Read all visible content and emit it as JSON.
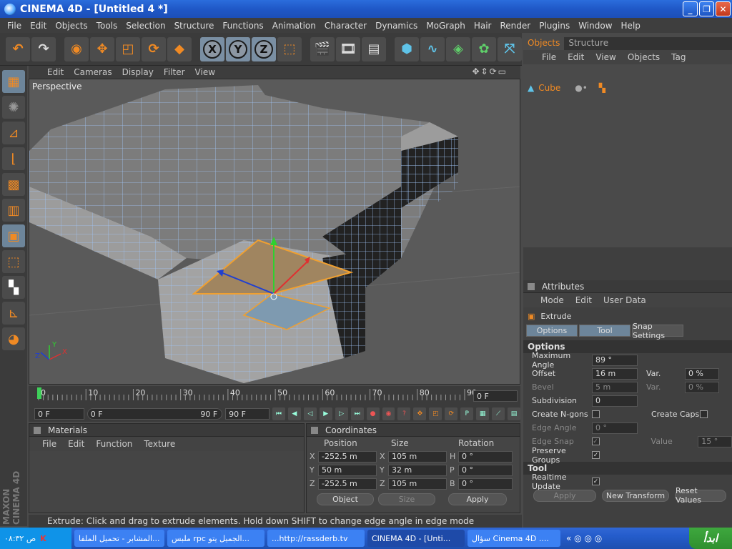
{
  "window": {
    "title": "CINEMA 4D - [Untitled 4 *]"
  },
  "menubar": [
    "File",
    "Edit",
    "Objects",
    "Tools",
    "Selection",
    "Structure",
    "Functions",
    "Animation",
    "Character",
    "Dynamics",
    "MoGraph",
    "Hair",
    "Render",
    "Plugins",
    "Window",
    "Help"
  ],
  "toolbar": {
    "axis_x": "X",
    "axis_y": "Y",
    "axis_z": "Z"
  },
  "viewport": {
    "menu": [
      "Edit",
      "Cameras",
      "Display",
      "Filter",
      "View"
    ],
    "label": "Perspective"
  },
  "timeline": {
    "ticks": [
      "0",
      "10",
      "20",
      "30",
      "40",
      "50",
      "60",
      "70",
      "80",
      "90"
    ],
    "current_frame": "0 F"
  },
  "time_controls": {
    "start": "0 F",
    "range_start": "0 F",
    "range_end": "90 F",
    "end": "90 F"
  },
  "materials": {
    "title": "Materials",
    "menu": [
      "File",
      "Edit",
      "Function",
      "Texture"
    ]
  },
  "coordinates": {
    "title": "Coordinates",
    "headers": [
      "Position",
      "Size",
      "Rotation"
    ],
    "rows": [
      {
        "axis": "X",
        "pos": "-252.5 m",
        "saxis": "X",
        "size": "105 m",
        "raxis": "H",
        "rot": "0 °"
      },
      {
        "axis": "Y",
        "pos": "50 m",
        "saxis": "Y",
        "size": "32 m",
        "raxis": "P",
        "rot": "0 °"
      },
      {
        "axis": "Z",
        "pos": "-252.5 m",
        "saxis": "Z",
        "size": "105 m",
        "raxis": "B",
        "rot": "0 °"
      }
    ],
    "mode": "Object",
    "size_mode": "Size",
    "apply": "Apply"
  },
  "status": "Extrude: Click and drag to extrude elements. Hold down SHIFT to change edge angle in edge mode",
  "objects_panel": {
    "tabs": [
      "Objects",
      "Structure"
    ],
    "menu": [
      "File",
      "Edit",
      "View",
      "Objects",
      "Tag"
    ],
    "items": [
      {
        "name": "Cube"
      }
    ]
  },
  "attributes": {
    "title": "Attributes",
    "menu": [
      "Mode",
      "Edit",
      "User Data"
    ],
    "tool_name": "Extrude",
    "tabs": [
      "Options",
      "Tool",
      "Snap Settings"
    ],
    "options_header": "Options",
    "max_angle_label": "Maximum Angle",
    "max_angle": "89 °",
    "offset_label": "Offset",
    "offset": "16 m",
    "var1_label": "Var.",
    "var1": "0 %",
    "bevel_label": "Bevel",
    "bevel": "5 m",
    "var2_label": "Var.",
    "var2": "0 %",
    "subdivision_label": "Subdivision",
    "subdivision": "0",
    "create_ngons": "Create N-gons",
    "create_caps": "Create Caps",
    "edge_angle_label": "Edge Angle",
    "edge_angle": "0 °",
    "edge_snap_label": "Edge Snap",
    "value_label": "Value",
    "value": "15 °",
    "preserve_groups": "Preserve Groups",
    "tool_header": "Tool",
    "realtime_update": "Realtime Update",
    "apply": "Apply",
    "new_transform": "New Transform",
    "reset_values": "Reset Values"
  },
  "taskbar": {
    "clock": "۰۸:۳۲ ص",
    "tasks": [
      "المشابر - تحميل الملفا...",
      "ملبس rpc الجميل يتو...",
      "...http://rassderb.tv",
      "CINEMA 4D - [Unti...",
      "سؤال Cinema 4D ...."
    ],
    "start": "ابدأ"
  }
}
